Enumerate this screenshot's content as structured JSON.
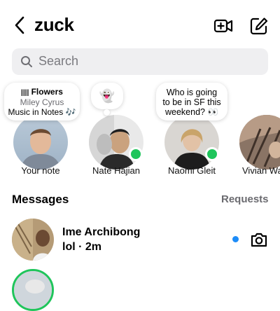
{
  "header": {
    "title": "zuck"
  },
  "search": {
    "placeholder": "Search"
  },
  "notes": [
    {
      "name": "Your note",
      "song_title": "Flowers",
      "song_artist": "Miley Cyrus",
      "note_caption": "Music in Notes 🎶"
    },
    {
      "name": "Nate Hajian",
      "note_emoji": "👻"
    },
    {
      "name": "Naomi Gleit",
      "note_line1": "Who is going",
      "note_line2": "to be in SF this",
      "note_line3": "weekend? 👀"
    },
    {
      "name": "Vivian Wa"
    }
  ],
  "messages_section": {
    "title": "Messages",
    "requests_label": "Requests"
  },
  "threads": [
    {
      "name": "Ime Archibong",
      "preview": "lol · 2m"
    }
  ],
  "colors": {
    "accent_blue": "#1d8cf8",
    "online_green": "#1fc55b"
  }
}
